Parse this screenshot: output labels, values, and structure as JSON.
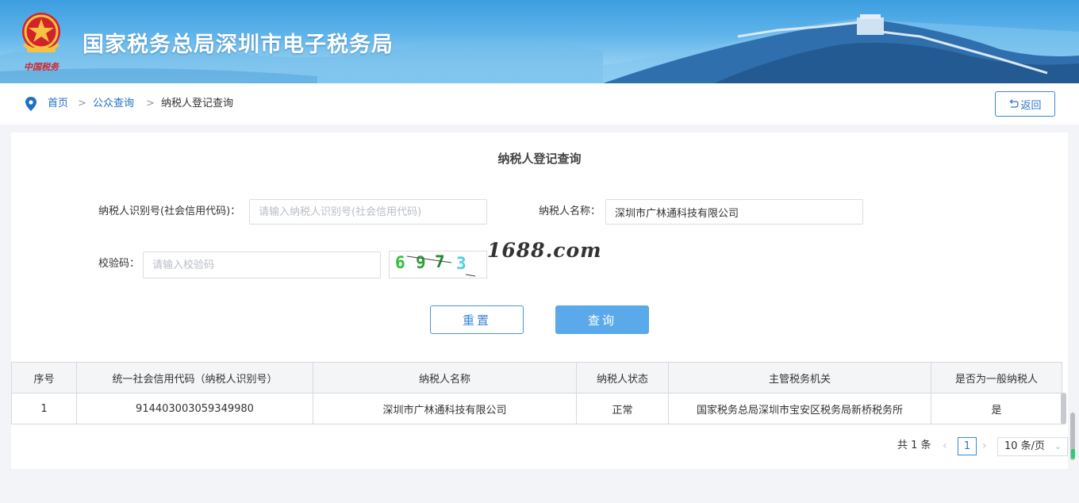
{
  "header": {
    "site_title": "国家税务总局深圳市电子税务局",
    "emblem_icon": "tax-emblem-icon"
  },
  "breadcrumb": {
    "home": "首页",
    "public_query": "公众查询",
    "current": "纳税人登记查询",
    "separator": ">",
    "back_label": "返回"
  },
  "form": {
    "title": "纳税人登记查询",
    "taxpayer_id_label": "纳税人识别号(社会信用代码)：",
    "taxpayer_id_placeholder": "请输入纳税人识别号(社会信用代码)",
    "taxpayer_id_value": "",
    "taxpayer_name_label": "纳税人名称：",
    "taxpayer_name_value": "深圳市广林通科技有限公司",
    "captcha_label": "校验码：",
    "captcha_placeholder": "请输入校验码",
    "captcha_chars": [
      "6",
      "9",
      "7",
      "3"
    ],
    "watermark": "1688.com",
    "reset_label": "重置",
    "query_label": "查询"
  },
  "table": {
    "columns": [
      "序号",
      "统一社会信用代码（纳税人识别号）",
      "纳税人名称",
      "纳税人状态",
      "主管税务机关",
      "是否为一般纳税人"
    ],
    "rows": [
      {
        "index": "1",
        "credit_code": "914403003059349980",
        "name": "深圳市广林通科技有限公司",
        "status": "正常",
        "authority": "国家税务总局深圳市宝安区税务局新桥税务所",
        "general_taxpayer": "是"
      }
    ]
  },
  "pagination": {
    "total_text": "共 1 条",
    "current_page": "1",
    "page_size": "10 条/页"
  },
  "colors": {
    "accent": "#3a86d3",
    "query_button": "#5aa9ea",
    "link": "#1f6fc7"
  }
}
